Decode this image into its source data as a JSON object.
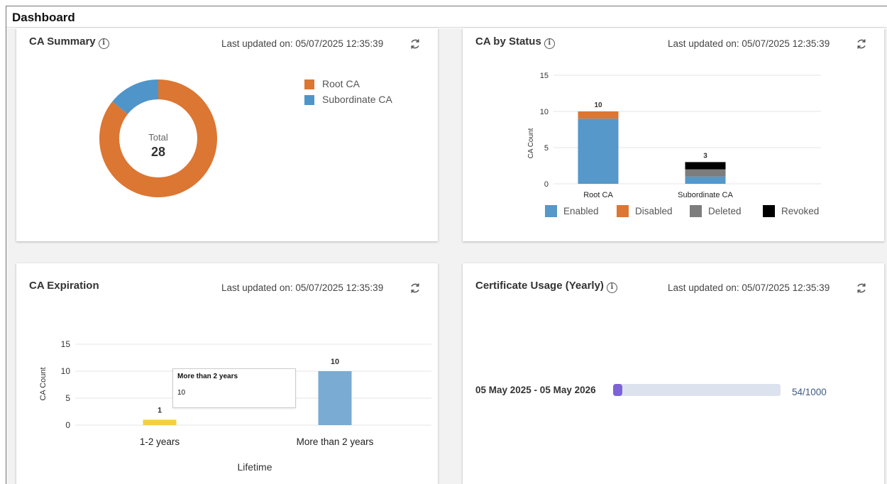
{
  "page_title": "Dashboard",
  "updated_label": "Last updated on: 05/07/2025 12:35:39",
  "colors": {
    "root": "#dc7633",
    "subordinate": "#4f95c9",
    "enabled": "#5598c9",
    "disabled": "#dc7633",
    "deleted": "#7d7d7d",
    "revoked": "#000000",
    "yellow": "#f4d03f",
    "purple": "#7e63d6",
    "track": "#dde3ee"
  },
  "ca_summary": {
    "title": "CA Summary",
    "center_label": "Total",
    "total": "28",
    "legend": [
      "Root CA",
      "Subordinate CA"
    ],
    "chart_data": {
      "type": "pie",
      "labels": [
        "Root CA",
        "Subordinate CA"
      ],
      "values": [
        24,
        4
      ],
      "colors": [
        "#dc7633",
        "#4f95c9"
      ]
    }
  },
  "ca_by_status": {
    "title": "CA by Status",
    "ylabel": "CA Count",
    "legend": [
      "Enabled",
      "Disabled",
      "Deleted",
      "Revoked"
    ],
    "chart_data": {
      "type": "bar",
      "stacked": true,
      "categories": [
        "Root CA",
        "Subordinate CA"
      ],
      "series": [
        {
          "name": "Enabled",
          "values": [
            9,
            1
          ]
        },
        {
          "name": "Disabled",
          "values": [
            1,
            0
          ]
        },
        {
          "name": "Deleted",
          "values": [
            0,
            1
          ]
        },
        {
          "name": "Revoked",
          "values": [
            0,
            1
          ]
        }
      ],
      "totals": [
        "10",
        "3"
      ],
      "yticks": [
        "0",
        "5",
        "10",
        "15"
      ],
      "ylim": [
        0,
        15
      ],
      "ylabel": "CA Count",
      "legend_position": "bottom"
    }
  },
  "ca_expiration": {
    "title": "CA Expiration",
    "xlabel": "Lifetime",
    "ylabel": "CA Count",
    "tooltip": {
      "title": "More than 2 years",
      "value": "10"
    },
    "chart_data": {
      "type": "bar",
      "categories": [
        "1-2 years",
        "More than 2 years"
      ],
      "values": [
        1,
        10
      ],
      "value_labels": [
        "1",
        "10"
      ],
      "yticks": [
        "0",
        "5",
        "10",
        "15"
      ],
      "ylim": [
        0,
        15
      ],
      "xlabel": "Lifetime",
      "ylabel": "CA Count"
    }
  },
  "certificate_usage": {
    "title": "Certificate Usage (Yearly)",
    "period": "05 May 2025 - 05 May 2026",
    "usage_text": "54/1000",
    "used": 54,
    "limit": 1000
  }
}
